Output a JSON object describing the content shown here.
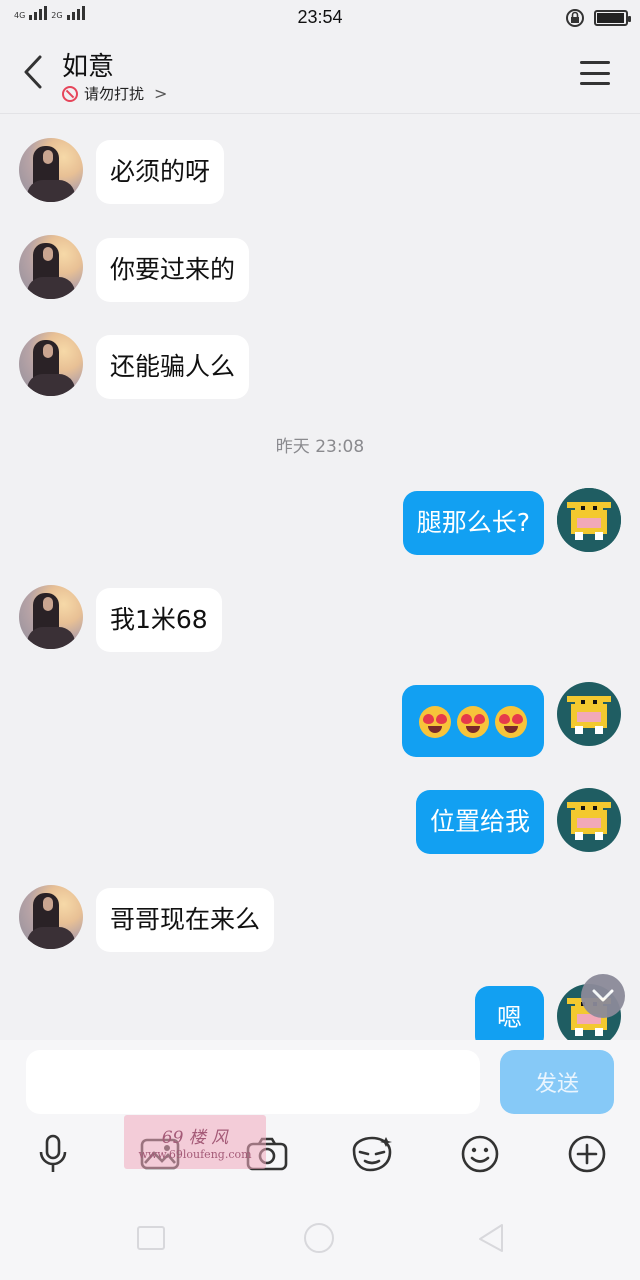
{
  "status_bar": {
    "time": "23:54",
    "network_1": "4G",
    "network_2": "2G",
    "battery_level": 0.95
  },
  "header": {
    "title": "如意",
    "status": "请勿打扰",
    "chevron": ">"
  },
  "messages": [
    {
      "side": "in",
      "text": "必须的呀"
    },
    {
      "side": "in",
      "text": "你要过来的"
    },
    {
      "side": "in",
      "text": "还能骗人么"
    },
    {
      "side": "timestamp",
      "text": "昨天 23:08"
    },
    {
      "side": "out",
      "text": "腿那么长?"
    },
    {
      "side": "in",
      "text": "我1米68"
    },
    {
      "side": "out",
      "text": "",
      "emoji": [
        "heart-eyes-emoji",
        "heart-eyes-emoji",
        "heart-eyes-emoji"
      ]
    },
    {
      "side": "out",
      "text": "位置给我"
    },
    {
      "side": "in",
      "text": "哥哥现在来么"
    },
    {
      "side": "out",
      "text": "嗯"
    }
  ],
  "input": {
    "placeholder": "",
    "value": "",
    "send_label": "发送"
  },
  "toolbar": {
    "icons": [
      "microphone-icon",
      "image-icon",
      "camera-icon",
      "sticker-icon",
      "emoji-icon",
      "plus-icon"
    ]
  },
  "watermark": {
    "main": "69 楼 风",
    "sub": "www.69loufeng.com"
  },
  "colors": {
    "accent": "#12a0f2",
    "background": "#f1f1f3",
    "send_disabled": "#86c9f7",
    "dnd": "#e6455a"
  }
}
